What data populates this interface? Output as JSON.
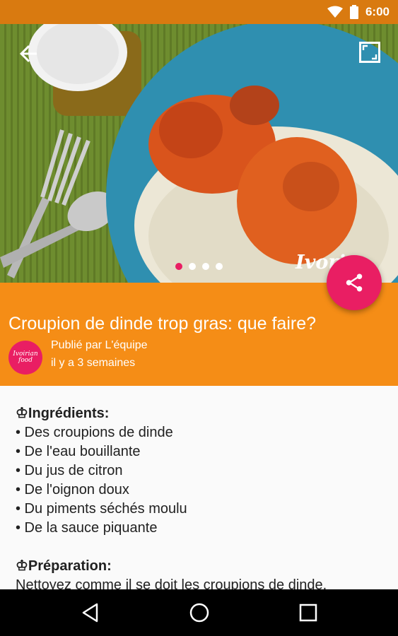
{
  "status_bar": {
    "time": "6:00",
    "icons": [
      "wifi-icon",
      "battery-icon"
    ]
  },
  "hero": {
    "watermark": "Ivori",
    "slides": 4,
    "active_slide": 1
  },
  "article": {
    "title": "Croupion de dinde trop gras: que faire?",
    "author_line": "Publié par L'équipe",
    "time_ago": "il y a 3 semaines",
    "avatar_text": "Ivoirian food"
  },
  "ingredients": {
    "heading": "♔Ingrédients:",
    "items": [
      "• Des croupions de dinde",
      "• De l'eau bouillante",
      "• Du jus de citron",
      "• De l'oignon doux",
      "• Du piments séchés moulu",
      "• De la sauce piquante"
    ]
  },
  "preparation": {
    "heading": "♔Préparation:",
    "text": "Nettoyez comme il se doit les croupions de dinde."
  },
  "colors": {
    "status": "#d97a10",
    "header": "#f58d16",
    "accent": "#e91e63"
  }
}
